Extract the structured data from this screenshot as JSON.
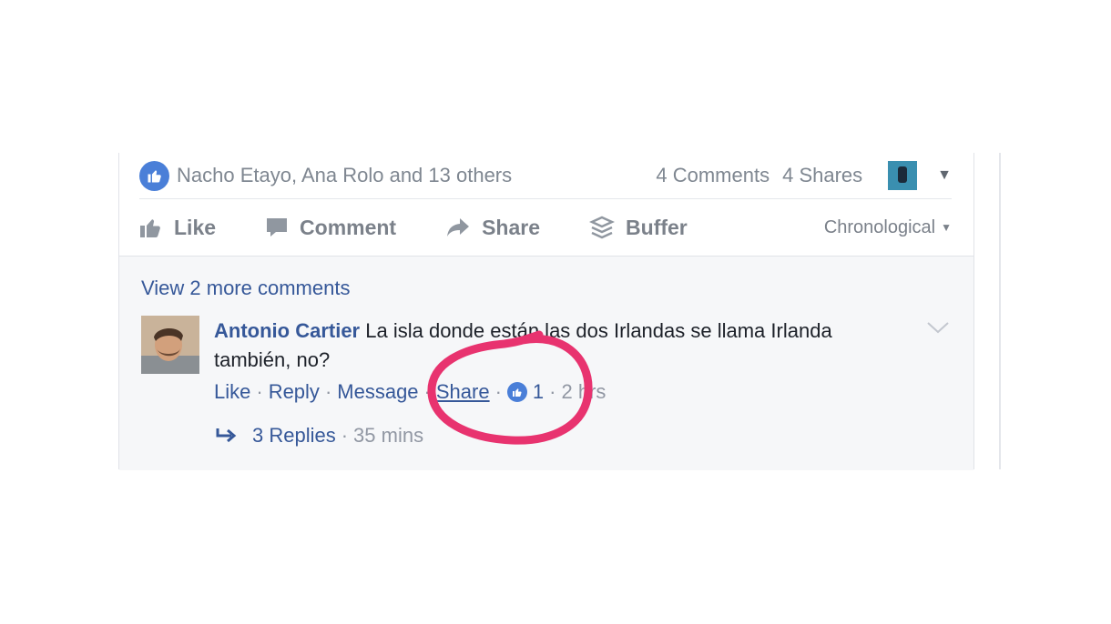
{
  "post": {
    "likes_summary": "Nacho Etayo, Ana Rolo and 13 others",
    "comments_count": "4 Comments",
    "shares_count": "4 Shares"
  },
  "actions": {
    "like": "Like",
    "comment": "Comment",
    "share": "Share",
    "buffer": "Buffer",
    "sort": "Chronological"
  },
  "comments": {
    "view_more": "View 2 more comments",
    "items": [
      {
        "author": "Antonio Cartier",
        "text": "La isla donde están las dos Irlandas se llama Irlanda también, no?",
        "like": "Like",
        "reply": "Reply",
        "message": "Message",
        "share": "Share",
        "like_count": "1",
        "time": "2 hrs",
        "replies": "3 Replies",
        "replies_time": "35 mins"
      }
    ]
  },
  "colors": {
    "link": "#365899",
    "like_blue": "#4a7fd8",
    "highlight": "#e8336f"
  },
  "icons": [
    "like-icon",
    "comment-icon",
    "share-arrow-icon",
    "buffer-icon",
    "chevron-down-icon",
    "reply-arrow-icon"
  ]
}
